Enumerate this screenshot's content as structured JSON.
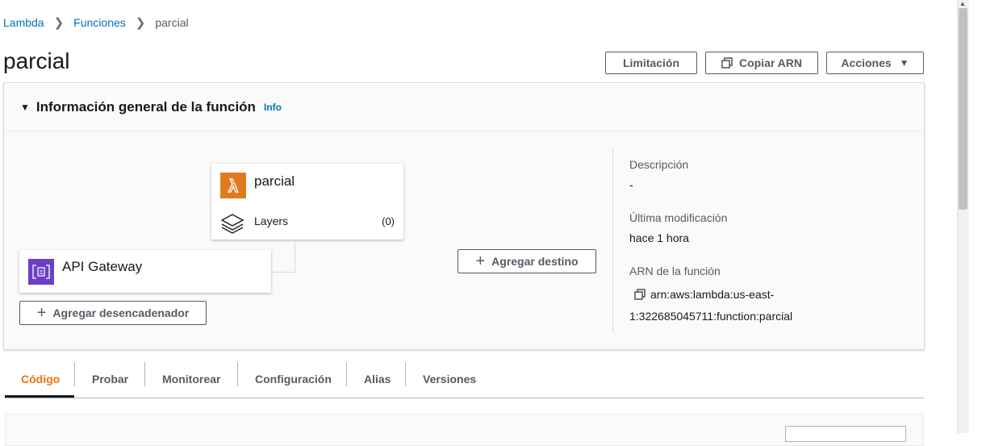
{
  "breadcrumb": {
    "items": [
      "Lambda",
      "Funciones"
    ],
    "current": "parcial"
  },
  "page_title": "parcial",
  "toolbar": {
    "limit_label": "Limitación",
    "copy_arn_label": "Copiar ARN",
    "actions_label": "Acciones"
  },
  "overview": {
    "title": "Información general de la función",
    "info": "Info"
  },
  "function_card": {
    "name": "parcial",
    "layers_label": "Layers",
    "layers_count": "(0)"
  },
  "trigger": {
    "name": "API Gateway",
    "add_trigger_label": "Agregar desencadenador"
  },
  "destination": {
    "add_label": "Agregar destino"
  },
  "details": {
    "description_label": "Descripción",
    "description_value": "-",
    "modified_label": "Última modificación",
    "modified_value": "hace 1 hora",
    "arn_label": "ARN de la función",
    "arn_line1": "arn:aws:lambda:us-east-",
    "arn_line2": "1:322685045711:function:parcial"
  },
  "tabs": [
    "Código",
    "Probar",
    "Monitorear",
    "Configuración",
    "Alias",
    "Versiones"
  ],
  "colors": {
    "accent": "#ec7211",
    "link": "#0073bb",
    "lambda": "#e07a1f",
    "apigw": "#6b3fc7"
  }
}
